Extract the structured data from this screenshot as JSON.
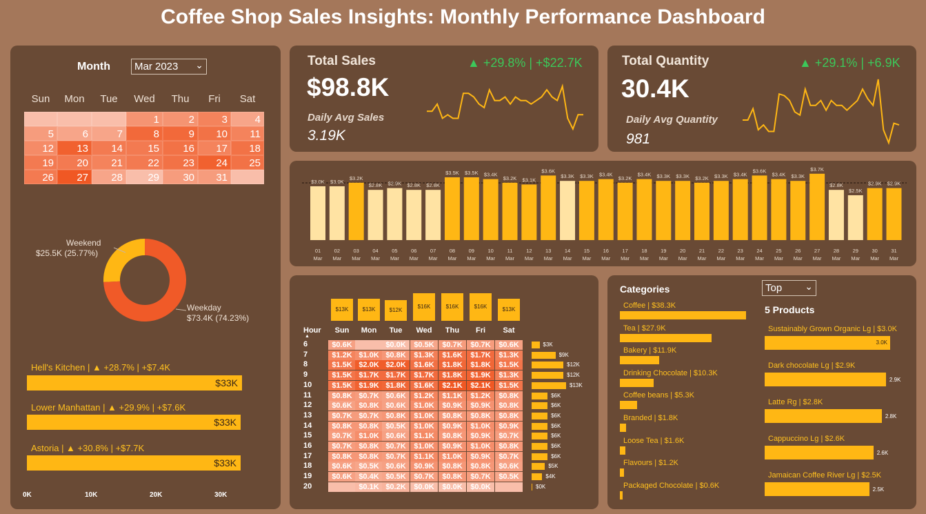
{
  "header": {
    "title": "Coffee Shop Sales Insights: Monthly Performance Dashboard"
  },
  "colors": {
    "background": "#A4775A",
    "panel": "#694A35",
    "accent": "#FFB714",
    "up": "#3CC85A",
    "weekday": "#F05A28",
    "weekend": "#FFB714",
    "heat_low": "#F8B9A5",
    "heat_high": "#F05A28"
  },
  "calendar": {
    "label": "Month",
    "selected_month": "Mar 2023",
    "days": [
      "Sun",
      "Mon",
      "Tue",
      "Wed",
      "Thu",
      "Fri",
      "Sat"
    ],
    "weeks": [
      [
        "",
        "",
        "",
        "1",
        "2",
        "3",
        "4"
      ],
      [
        "5",
        "6",
        "7",
        "8",
        "9",
        "10",
        "11"
      ],
      [
        "12",
        "13",
        "14",
        "15",
        "16",
        "17",
        "18"
      ],
      [
        "19",
        "20",
        "21",
        "22",
        "23",
        "24",
        "25"
      ],
      [
        "26",
        "27",
        "28",
        "29",
        "30",
        "31",
        ""
      ]
    ]
  },
  "donut": {
    "weekend_label": "Weekend",
    "weekend_value": "$25.5K (25.77%)",
    "weekday_label": "Weekday",
    "weekday_value": "$73.4K (74.23%)"
  },
  "stores": {
    "items": [
      {
        "label": "Hell's Kitchen | ▲ +28.7% | +$7.4K",
        "value": "$33K"
      },
      {
        "label": "Lower Manhattan | ▲ +29.9% | +$7.6K",
        "value": "$33K"
      },
      {
        "label": "Astoria | ▲ +30.8% | +$7.7K",
        "value": "$33K"
      }
    ],
    "axis": [
      "0K",
      "10K",
      "20K",
      "30K"
    ]
  },
  "kpi_sales": {
    "title": "Total Sales",
    "value": "$98.8K",
    "change": "▲ +29.8% | +$22.7K",
    "sub_label": "Daily Avg Sales",
    "sub_value": "3.19K"
  },
  "kpi_quantity": {
    "title": "Total Quantity",
    "value": "30.4K",
    "change": "▲ +29.1% | +6.9K",
    "sub_label": "Daily Avg Quantity",
    "sub_value": "981"
  },
  "chart_data": [
    {
      "type": "bar",
      "categories": [
        "01",
        "02",
        "03",
        "04",
        "05",
        "06",
        "07",
        "08",
        "09",
        "10",
        "11",
        "12",
        "13",
        "14",
        "15",
        "16",
        "17",
        "18",
        "19",
        "20",
        "21",
        "22",
        "23",
        "24",
        "25",
        "26",
        "27",
        "28",
        "29",
        "30",
        "31"
      ],
      "sublabel": "Mar",
      "values": [
        3.0,
        3.0,
        3.2,
        2.8,
        2.9,
        2.8,
        2.8,
        3.5,
        3.5,
        3.4,
        3.2,
        3.1,
        3.6,
        3.3,
        3.3,
        3.4,
        3.2,
        3.4,
        3.3,
        3.3,
        3.2,
        3.3,
        3.4,
        3.6,
        3.4,
        3.3,
        3.7,
        2.8,
        2.5,
        2.9,
        2.9
      ],
      "labels": [
        "$3.0K",
        "$3.0K",
        "$3.2K",
        "$2.8K",
        "$2.9K",
        "$2.8K",
        "$2.8K",
        "$3.5K",
        "$3.5K",
        "$3.4K",
        "$3.2K",
        "$3.1K",
        "$3.6K",
        "$3.3K",
        "$3.3K",
        "$3.4K",
        "$3.2K",
        "$3.4K",
        "$3.3K",
        "$3.3K",
        "$3.2K",
        "$3.3K",
        "$3.4K",
        "$3.6K",
        "$3.4K",
        "$3.3K",
        "$3.7K",
        "$2.8K",
        "$2.5K",
        "$2.9K",
        "$2.9K"
      ],
      "below_avg": [
        1,
        1,
        0,
        1,
        1,
        1,
        1,
        0,
        0,
        0,
        0,
        0,
        0,
        1,
        0,
        0,
        0,
        0,
        0,
        0,
        0,
        0,
        0,
        0,
        0,
        0,
        0,
        1,
        1,
        0,
        0
      ],
      "average": 3.19
    },
    {
      "type": "line",
      "name_hint": "daily sales sparkline",
      "values": [
        3.0,
        3.0,
        3.2,
        2.8,
        2.9,
        2.8,
        2.8,
        3.5,
        3.5,
        3.4,
        3.2,
        3.1,
        3.6,
        3.3,
        3.3,
        3.4,
        3.2,
        3.4,
        3.3,
        3.3,
        3.2,
        3.3,
        3.4,
        3.6,
        3.4,
        3.3,
        3.7,
        2.8,
        2.5,
        2.9,
        2.9
      ]
    },
    {
      "type": "line",
      "name_hint": "daily quantity sparkline",
      "values": [
        900,
        900,
        970,
        840,
        870,
        830,
        830,
        1060,
        1050,
        1020,
        950,
        930,
        1090,
        990,
        990,
        1020,
        960,
        1020,
        990,
        990,
        960,
        990,
        1020,
        1090,
        1030,
        990,
        1150,
        840,
        760,
        880,
        870
      ]
    },
    {
      "type": "heatmap",
      "days": [
        "Sun",
        "Mon",
        "Tue",
        "Wed",
        "Thu",
        "Fri",
        "Sat"
      ],
      "hour_label": "Hour",
      "hours": [
        "6",
        "7",
        "8",
        "9",
        "10",
        "11",
        "12",
        "13",
        "14",
        "15",
        "16",
        "17",
        "18",
        "19",
        "20"
      ],
      "cells": [
        [
          "$0.6K",
          "",
          "$0.0K",
          "$0.5K",
          "$0.7K",
          "$0.7K",
          "$0.6K"
        ],
        [
          "$1.2K",
          "$1.0K",
          "$0.8K",
          "$1.3K",
          "$1.6K",
          "$1.7K",
          "$1.3K"
        ],
        [
          "$1.5K",
          "$2.0K",
          "$2.0K",
          "$1.6K",
          "$1.8K",
          "$1.8K",
          "$1.5K"
        ],
        [
          "$1.5K",
          "$1.7K",
          "$1.7K",
          "$1.7K",
          "$1.8K",
          "$1.9K",
          "$1.3K"
        ],
        [
          "$1.5K",
          "$1.9K",
          "$1.8K",
          "$1.6K",
          "$2.1K",
          "$2.1K",
          "$1.5K"
        ],
        [
          "$0.8K",
          "$0.7K",
          "$0.6K",
          "$1.2K",
          "$1.1K",
          "$1.2K",
          "$0.8K"
        ],
        [
          "$0.6K",
          "$0.8K",
          "$0.6K",
          "$1.0K",
          "$0.9K",
          "$0.9K",
          "$0.8K"
        ],
        [
          "$0.7K",
          "$0.7K",
          "$0.8K",
          "$1.0K",
          "$0.8K",
          "$0.8K",
          "$0.8K"
        ],
        [
          "$0.8K",
          "$0.8K",
          "$0.5K",
          "$1.0K",
          "$0.9K",
          "$1.0K",
          "$0.9K"
        ],
        [
          "$0.7K",
          "$1.0K",
          "$0.6K",
          "$1.1K",
          "$0.8K",
          "$0.9K",
          "$0.7K"
        ],
        [
          "$0.7K",
          "$0.8K",
          "$0.7K",
          "$1.0K",
          "$0.9K",
          "$1.0K",
          "$0.8K"
        ],
        [
          "$0.8K",
          "$0.8K",
          "$0.7K",
          "$1.1K",
          "$1.0K",
          "$0.9K",
          "$0.7K"
        ],
        [
          "$0.6K",
          "$0.5K",
          "$0.6K",
          "$0.9K",
          "$0.8K",
          "$0.8K",
          "$0.6K"
        ],
        [
          "$0.6K",
          "$0.4K",
          "$0.5K",
          "$0.7K",
          "$0.8K",
          "$0.7K",
          "$0.5K"
        ],
        [
          "",
          "$0.1K",
          "$0.2K",
          "$0.0K",
          "$0.0K",
          "$0.0K",
          ""
        ]
      ],
      "values": [
        [
          0.6,
          null,
          0.0,
          0.5,
          0.7,
          0.7,
          0.6
        ],
        [
          1.2,
          1.0,
          0.8,
          1.3,
          1.6,
          1.7,
          1.3
        ],
        [
          1.5,
          2.0,
          2.0,
          1.6,
          1.8,
          1.8,
          1.5
        ],
        [
          1.5,
          1.7,
          1.7,
          1.7,
          1.8,
          1.9,
          1.3
        ],
        [
          1.5,
          1.9,
          1.8,
          1.6,
          2.1,
          2.1,
          1.5
        ],
        [
          0.8,
          0.7,
          0.6,
          1.2,
          1.1,
          1.2,
          0.8
        ],
        [
          0.6,
          0.8,
          0.6,
          1.0,
          0.9,
          0.9,
          0.8
        ],
        [
          0.7,
          0.7,
          0.8,
          1.0,
          0.8,
          0.8,
          0.8
        ],
        [
          0.8,
          0.8,
          0.5,
          1.0,
          0.9,
          1.0,
          0.9
        ],
        [
          0.7,
          1.0,
          0.6,
          1.1,
          0.8,
          0.9,
          0.7
        ],
        [
          0.7,
          0.8,
          0.7,
          1.0,
          0.9,
          1.0,
          0.8
        ],
        [
          0.8,
          0.8,
          0.7,
          1.1,
          1.0,
          0.9,
          0.7
        ],
        [
          0.6,
          0.5,
          0.6,
          0.9,
          0.8,
          0.8,
          0.6
        ],
        [
          0.6,
          0.4,
          0.5,
          0.7,
          0.8,
          0.7,
          0.5
        ],
        [
          null,
          0.1,
          0.2,
          0.0,
          0.0,
          0.0,
          null
        ]
      ],
      "day_totals": [
        13,
        13,
        12,
        16,
        16,
        16,
        13
      ],
      "day_total_labels": [
        "$13K",
        "$13K",
        "$12K",
        "$16K",
        "$16K",
        "$16K",
        "$13K"
      ],
      "hour_totals": [
        3,
        9,
        12,
        12,
        13,
        6,
        6,
        6,
        6,
        6,
        6,
        6,
        5,
        4,
        0
      ],
      "hour_total_labels": [
        "$3K",
        "$9K",
        "$12K",
        "$12K",
        "$13K",
        "$6K",
        "$6K",
        "$6K",
        "$6K",
        "$6K",
        "$6K",
        "$6K",
        "$5K",
        "$4K",
        "$0K"
      ]
    },
    {
      "type": "bar",
      "title": "Categories",
      "categories": [
        "Coffee",
        "Tea",
        "Bakery",
        "Drinking Chocolate",
        "Coffee beans",
        "Branded",
        "Loose Tea",
        "Flavours",
        "Packaged Chocolate"
      ],
      "labels": [
        "Coffee | $38.3K",
        "Tea | $27.9K",
        "Bakery | $11.9K",
        "Drinking Chocolate | $10.3K",
        "Coffee beans | $5.3K",
        "Branded | $1.8K",
        "Loose Tea | $1.6K",
        "Flavours | $1.2K",
        "Packaged Chocolate | $0.6K"
      ],
      "values": [
        38.3,
        27.9,
        11.9,
        10.3,
        5.3,
        1.8,
        1.6,
        1.2,
        0.6
      ]
    },
    {
      "type": "bar",
      "title": "5 Products",
      "selector": "Top",
      "categories": [
        "Sustainably Grown Organic Lg",
        "Dark chocolate Lg",
        "Latte Rg",
        "Cappuccino Lg",
        "Jamaican Coffee River Lg"
      ],
      "labels": [
        "Sustainably Grown Organic Lg | $3.0K",
        "Dark chocolate Lg | $2.9K",
        "Latte Rg | $2.8K",
        "Cappuccino Lg | $2.6K",
        "Jamaican Coffee River Lg | $2.5K"
      ],
      "value_labels": [
        "3.0K",
        "2.9K",
        "2.8K",
        "2.6K",
        "2.5K"
      ],
      "values": [
        3.0,
        2.9,
        2.8,
        2.6,
        2.5
      ]
    }
  ]
}
